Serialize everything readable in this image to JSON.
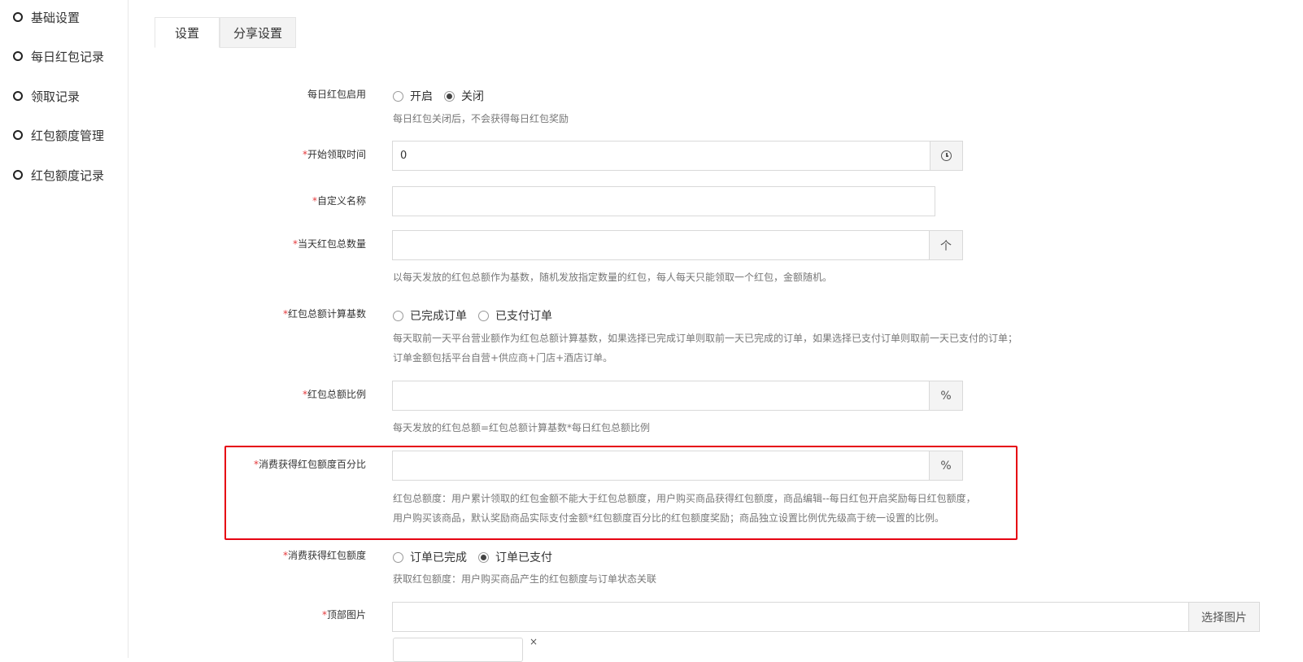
{
  "sidebar": {
    "items": [
      {
        "label": "基础设置"
      },
      {
        "label": "每日红包记录"
      },
      {
        "label": "领取记录"
      },
      {
        "label": "红包额度管理"
      },
      {
        "label": "红包额度记录"
      }
    ]
  },
  "tabs": [
    {
      "label": "设置",
      "active": true
    },
    {
      "label": "分享设置",
      "active": false
    }
  ],
  "form": {
    "enable": {
      "label": "每日红包启用",
      "options": [
        "开启",
        "关闭"
      ],
      "selected": "关闭",
      "help": "每日红包关闭后，不会获得每日红包奖励"
    },
    "start_time": {
      "required_mark": "*",
      "label": "开始领取时间",
      "value": "0",
      "addon_icon": "clock-icon"
    },
    "custom_name": {
      "required_mark": "*",
      "label": "自定义名称",
      "value": ""
    },
    "daily_total_count": {
      "required_mark": "*",
      "label": "当天红包总数量",
      "value": "",
      "addon": "个",
      "help": "以每天发放的红包总额作为基数，随机发放指定数量的红包，每人每天只能领取一个红包，金额随机。"
    },
    "total_basis": {
      "required_mark": "*",
      "label": "红包总额计算基数",
      "options": [
        "已完成订单",
        "已支付订单"
      ],
      "selected": "",
      "help_1": "每天取前一天平台营业额作为红包总额计算基数，如果选择已完成订单则取前一天已完成的订单，如果选择已支付订单则取前一天已支付的订单；",
      "help_2": "订单金额包括平台自营+供应商+门店+酒店订单。"
    },
    "total_ratio": {
      "required_mark": "*",
      "label": "红包总额比例",
      "value": "",
      "addon": "%",
      "help": "每天发放的红包总额=红包总额计算基数*每日红包总额比例"
    },
    "quota_percent": {
      "required_mark": "*",
      "label": "消费获得红包额度百分比",
      "value": "",
      "addon": "%",
      "help_1": "红包总额度：用户累计领取的红包金额不能大于红包总额度，用户购买商品获得红包额度，商品编辑--每日红包开启奖励每日红包额度，",
      "help_2": "用户购买该商品，默认奖励商品实际支付金额*红包额度百分比的红包额度奖励；商品独立设置比例优先级高于统一设置的比例。"
    },
    "quota_trigger": {
      "required_mark": "*",
      "label": "消费获得红包额度",
      "options": [
        "订单已完成",
        "订单已支付"
      ],
      "selected": "订单已支付",
      "help": "获取红包额度：用户购买商品产生的红包额度与订单状态关联"
    },
    "top_image": {
      "required_mark": "*",
      "label": "顶部图片",
      "value": "",
      "button": "选择图片",
      "remove": "×"
    }
  },
  "colors": {
    "highlight_border": "#e60012",
    "required": "#e4393c"
  }
}
